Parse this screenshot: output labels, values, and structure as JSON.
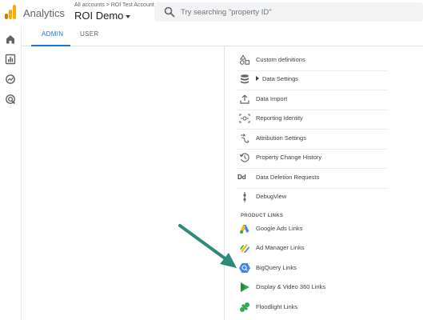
{
  "header": {
    "app_title": "Analytics",
    "breadcrumb": "All accounts > ROI Test Account",
    "property_name": "ROI Demo",
    "search_placeholder": "Try searching \"property ID\""
  },
  "rail": {
    "items": [
      {
        "icon": "home-icon"
      },
      {
        "icon": "reports-icon"
      },
      {
        "icon": "explore-icon"
      },
      {
        "icon": "advertising-icon"
      }
    ]
  },
  "tabs": [
    {
      "label": "ADMIN",
      "active": true
    },
    {
      "label": "USER",
      "active": false
    }
  ],
  "menu": {
    "items": [
      {
        "label": "Custom definitions",
        "icon": "shapes-icon"
      },
      {
        "label": "Data Settings",
        "icon": "database-icon",
        "expandable": true
      },
      {
        "label": "Data Import",
        "icon": "upload-icon"
      },
      {
        "label": "Reporting Identity",
        "icon": "identity-icon"
      },
      {
        "label": "Attribution Settings",
        "icon": "attribution-icon"
      },
      {
        "label": "Property Change History",
        "icon": "history-icon"
      },
      {
        "label": "Data Deletion Requests",
        "icon": "dd-icon",
        "icon_text": "Dd"
      },
      {
        "label": "DebugView",
        "icon": "debug-icon"
      }
    ],
    "product_links_heading": "PRODUCT LINKS",
    "product_links": [
      {
        "label": "Google Ads Links",
        "icon": "google-ads-icon"
      },
      {
        "label": "Ad Manager Links",
        "icon": "ad-manager-icon"
      },
      {
        "label": "BigQuery Links",
        "icon": "bigquery-icon"
      },
      {
        "label": "Display & Video 360 Links",
        "icon": "display-video-360-icon"
      },
      {
        "label": "Floodlight Links",
        "icon": "floodlight-icon"
      }
    ]
  },
  "colors": {
    "accent": "#1a73e8",
    "annotation_arrow": "#2e8b7a",
    "analytics_orange": "#f9ab00",
    "analytics_dark_orange": "#e37400"
  }
}
